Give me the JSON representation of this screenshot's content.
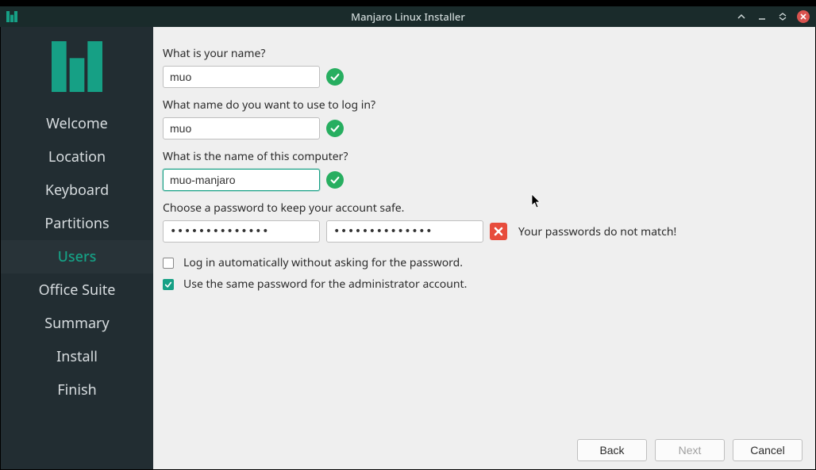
{
  "window": {
    "title": "Manjaro Linux Installer"
  },
  "sidebar": {
    "items": [
      {
        "label": "Welcome"
      },
      {
        "label": "Location"
      },
      {
        "label": "Keyboard"
      },
      {
        "label": "Partitions"
      },
      {
        "label": "Users"
      },
      {
        "label": "Office Suite"
      },
      {
        "label": "Summary"
      },
      {
        "label": "Install"
      },
      {
        "label": "Finish"
      }
    ],
    "active_index": 4
  },
  "form": {
    "name_label": "What is your name?",
    "name_value": "muo",
    "login_label": "What name do you want to use to log in?",
    "login_value": "muo",
    "hostname_label": "What is the name of this computer?",
    "hostname_value": "muo-manjaro",
    "password_label": "Choose a password to keep your account safe.",
    "password_value": "••••••••••••••",
    "password_confirm_value": "••••••••••••••",
    "password_error": "Your passwords do not match!",
    "auto_login_label": "Log in automatically without asking for the password.",
    "auto_login_checked": false,
    "same_admin_label": "Use the same password for the administrator account.",
    "same_admin_checked": true
  },
  "buttons": {
    "back": "Back",
    "next": "Next",
    "cancel": "Cancel"
  },
  "colors": {
    "accent": "#16a085",
    "sidebar_bg": "#222d32",
    "valid": "#27ae60",
    "error": "#e74c3c"
  }
}
